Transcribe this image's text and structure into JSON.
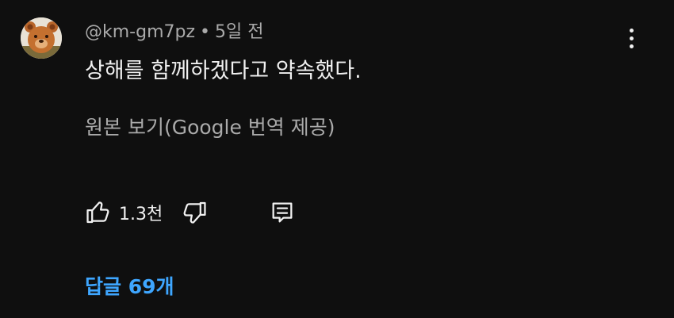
{
  "comment": {
    "author": "@km-gm7pz",
    "separator": "•",
    "time": "5일 전",
    "text": "상해를 함께하겠다고 약속했다.",
    "translation_link": "원본 보기(Google 번역 제공)",
    "like_count": "1.3천",
    "replies_link": "답글 69개",
    "avatar_icon": "bear-avatar-icon",
    "more_icon": "more-vert-icon",
    "like_icon": "thumb-up-icon",
    "dislike_icon": "thumb-down-icon",
    "reply_icon": "reply-comment-icon"
  },
  "colors": {
    "background": "#0f0f0f",
    "primary_text": "#f1f1f1",
    "secondary_text": "#aaaaaa",
    "link_blue": "#3ea6ff"
  }
}
